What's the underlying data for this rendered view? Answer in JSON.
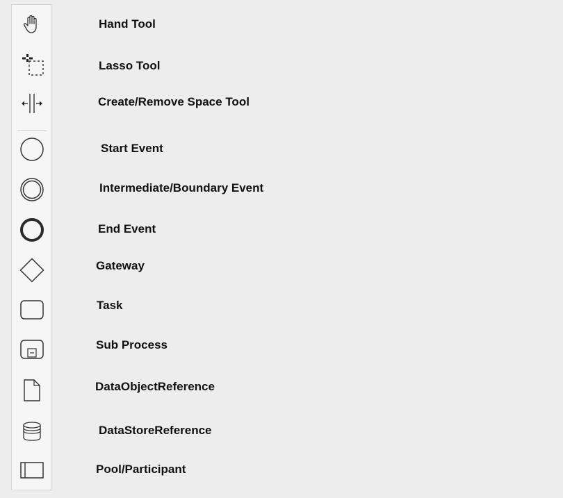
{
  "palette": {
    "tools": [
      {
        "id": "hand",
        "icon": "hand-icon",
        "label": "Hand Tool"
      },
      {
        "id": "lasso",
        "icon": "lasso-icon",
        "label": "Lasso Tool"
      },
      {
        "id": "space",
        "icon": "space-tool-icon",
        "label": "Create/Remove Space Tool"
      },
      {
        "id": "start-event",
        "icon": "start-event-icon",
        "label": "Start Event"
      },
      {
        "id": "intermediate-event",
        "icon": "intermediate-event-icon",
        "label": "Intermediate/Boundary Event"
      },
      {
        "id": "end-event",
        "icon": "end-event-icon",
        "label": "End Event"
      },
      {
        "id": "gateway",
        "icon": "gateway-icon",
        "label": "Gateway"
      },
      {
        "id": "task",
        "icon": "task-icon",
        "label": "Task"
      },
      {
        "id": "sub-process",
        "icon": "sub-process-icon",
        "label": "Sub Process"
      },
      {
        "id": "data-object",
        "icon": "data-object-icon",
        "label": "DataObjectReference"
      },
      {
        "id": "data-store",
        "icon": "data-store-icon",
        "label": "DataStoreReference"
      },
      {
        "id": "pool",
        "icon": "pool-icon",
        "label": "Pool/Participant"
      }
    ]
  },
  "colors": {
    "background": "#ededed",
    "palette_bg": "#f6f6f6",
    "icon_stroke": "#333333",
    "label_text": "#111111"
  }
}
